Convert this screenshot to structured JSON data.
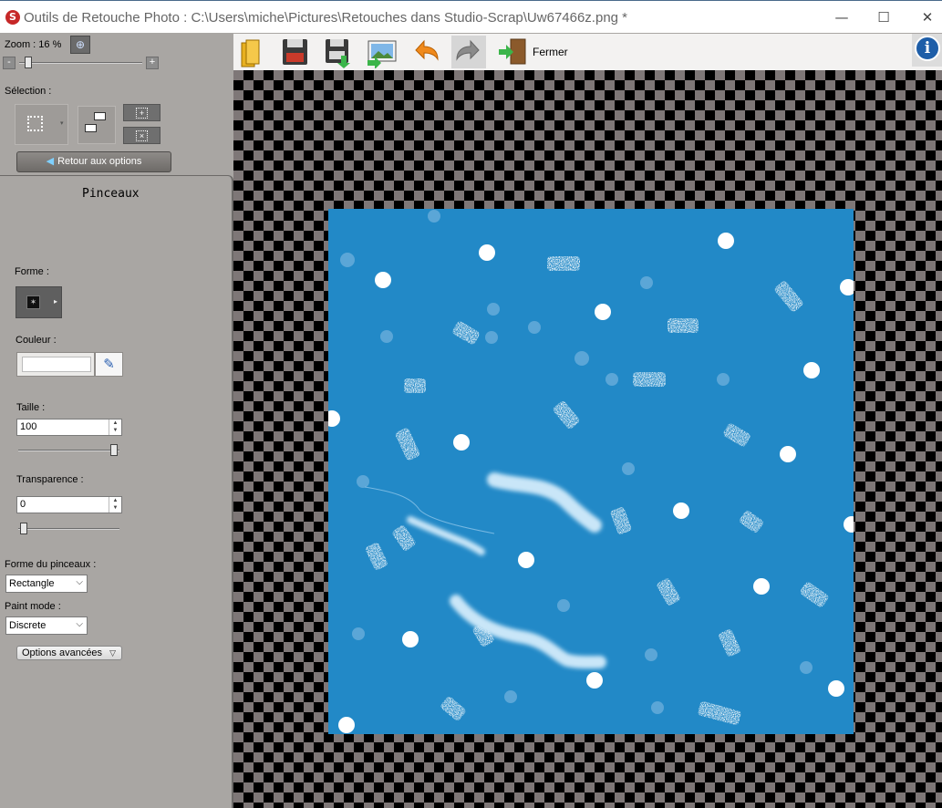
{
  "window": {
    "app_icon_letter": "S",
    "title": "Outils de Retouche Photo : C:\\Users\\miche\\Pictures\\Retouches dans Studio-Scrap\\Uw67466z.png *",
    "minimize": "—",
    "maximize": "☐",
    "close": "✕"
  },
  "zoom": {
    "label": "Zoom :  16 %",
    "minus": "-",
    "plus": "+",
    "level_percent": 16
  },
  "selection": {
    "label": "Sélection :"
  },
  "back_button": "Retour aux options",
  "panel": {
    "title": "Pinceaux",
    "forme_label": "Forme :",
    "couleur_label": "Couleur :",
    "couleur_value": "#ffffff",
    "taille_label": "Taille :",
    "taille_value": "100",
    "taille_slider_fraction": 1.0,
    "transparence_label": "Transparence :",
    "transparence_value": "0",
    "transparence_slider_fraction": 0.0,
    "forme_pinceau_label": "Forme du pinceaux :",
    "forme_pinceau_value": "Rectangle",
    "paint_mode_label": "Paint mode :",
    "paint_mode_value": "Discrete",
    "advanced_button": "Options avancées"
  },
  "toolbar": {
    "fermer_label": "Fermer",
    "icons": [
      "folder-open-icon",
      "save-icon",
      "save-as-icon",
      "export-image-icon",
      "undo-icon",
      "redo-icon",
      "close-exit-icon"
    ]
  },
  "canvas": {
    "background_color": "#2289c7"
  }
}
